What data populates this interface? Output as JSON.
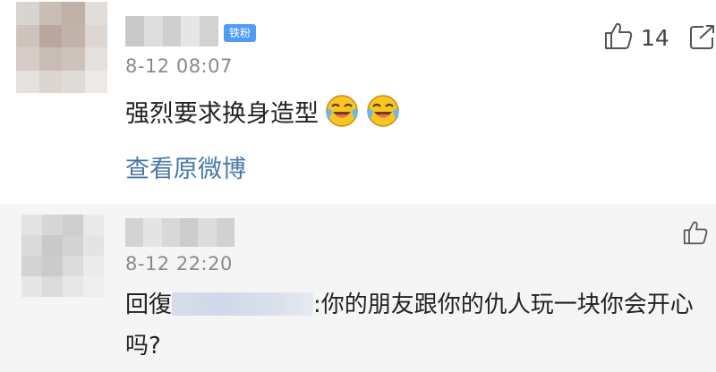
{
  "comment": {
    "author_badge": "铁粉",
    "time": "8-12 08:07",
    "text": "强烈要求换身造型",
    "view_original": "查看原微博",
    "like_count": "14"
  },
  "reply": {
    "time": "8-12 22:20",
    "prefix": "回復",
    "text": ":你的朋友跟你的仇人玩一块你会开心吗?"
  },
  "icons": {
    "like": "thumbs-up-icon",
    "share": "share-icon",
    "emoji": "crying-laugh-emoji-icon"
  }
}
